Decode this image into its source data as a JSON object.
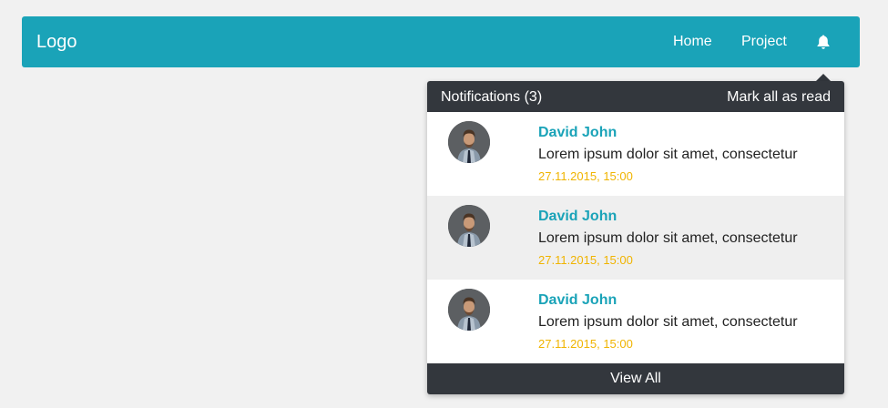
{
  "navbar": {
    "logo": "Logo",
    "links": [
      {
        "label": "Home"
      },
      {
        "label": "Project"
      }
    ],
    "bell_icon": "bell-icon",
    "color": "#1aa3b8"
  },
  "notifications": {
    "title": "Notifications (3)",
    "mark_all": "Mark all as read",
    "items": [
      {
        "name": "David John",
        "text": "Lorem ipsum dolor sit amet, consectetur",
        "time": "27.11.2015, 15:00",
        "avatar_icon": "avatar"
      },
      {
        "name": "David John",
        "text": "Lorem ipsum dolor sit amet, consectetur",
        "time": "27.11.2015, 15:00",
        "avatar_icon": "avatar"
      },
      {
        "name": "David John",
        "text": "Lorem ipsum dolor sit amet, consectetur",
        "time": "27.11.2015, 15:00",
        "avatar_icon": "avatar"
      }
    ],
    "view_all": "View All",
    "header_color": "#33373d",
    "time_color": "#f0b400"
  }
}
